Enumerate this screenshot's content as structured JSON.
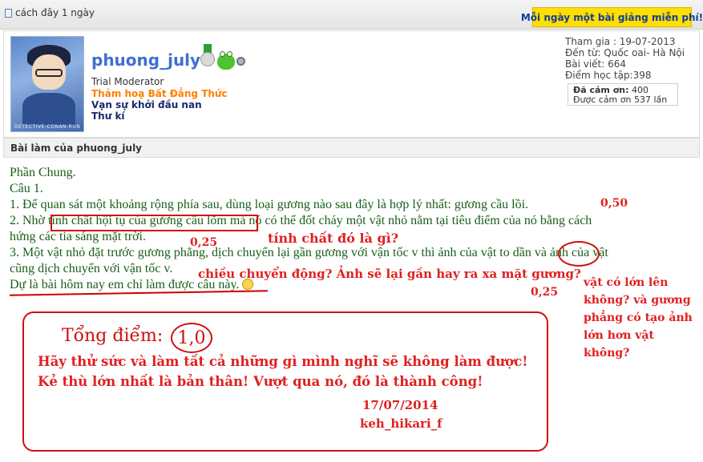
{
  "header": {
    "timestamp": "cách đây 1 ngày",
    "banner": "Mỗi ngày một bài giảng miễn phí!"
  },
  "user": {
    "username": "phuong_july",
    "rank": "Trial Moderator",
    "title": "Thảm hoạ Bất Đẳng Thức",
    "motto": "Vạn sự khởi đầu nan",
    "role": "Thư kí",
    "avatar_text": "DETECTIVE-CONAN-RUN",
    "stats": {
      "joined": "Tham gia : 19-07-2013",
      "from": "Đến từ: Quốc oai- Hà Nội",
      "posts": "Bài viết: 664",
      "study_points": "Điểm học tập:398",
      "thanked_label": "Đã cảm ơn:",
      "thanked_value": "400",
      "was_thanked": "Được cảm ơn 537 lần"
    }
  },
  "post": {
    "header": "Bài làm của phuong_july",
    "lines": {
      "l1": "Phần Chung.",
      "l2": "Câu 1.",
      "l3": "1. Để quan sát một khoảng rộng phía sau, dùng loại gương nào sau đây là hợp lý nhất: gương cầu lồi.",
      "l4": "2. Nhờ tính chất hội tụ của gương cầu lõm mà nó có thể đốt cháy một vật nhỏ nằm tại tiêu điểm của nó bằng cách",
      "l5": "hứng các tia sáng mặt trời.",
      "l6": "3. Một vật nhỏ đặt trước gương phẳng, dịch chuyển lại gần gương với vận tốc v thì ảnh của vật to dần và ảnh của vật",
      "l7": "cũng dịch chuyển với vận tốc v.",
      "l8": "Dự là bài hôm nay em chỉ làm được câu này."
    }
  },
  "annotations": {
    "score1": "0,50",
    "score2": "0,25",
    "q2": "tính chất đó là gì?",
    "q3": "chiều chuyển động? Ảnh sẽ lại gần hay ra xa mặt gương?",
    "score3": "0,25",
    "side_note": [
      "vật có lớn lên",
      "không? và gương",
      "phẳng có tạo ảnh",
      "lớn hơn vật",
      "không?"
    ],
    "total_label": "Tổng điểm:",
    "total_value": "1,0",
    "msg1": "Hãy thử sức và làm tất cả những gì mình nghĩ sẽ không làm được!",
    "msg2": "Kẻ thù lớn nhất là bản thân! Vượt qua nó, đó là thành công!",
    "date": "17/07/2014",
    "signature": "keh_hikari_f"
  }
}
